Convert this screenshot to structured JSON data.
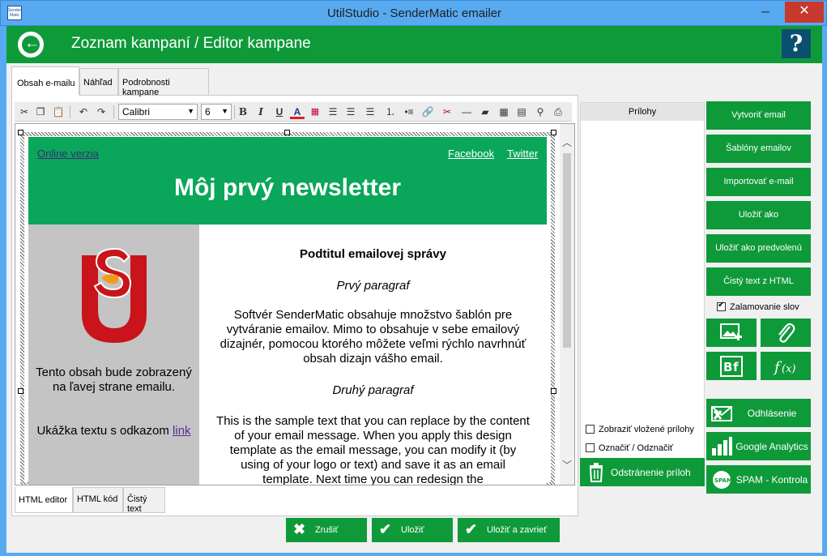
{
  "window": {
    "title": "UtilStudio - SenderMatic emailer",
    "app_icon_text": "Sender Matic"
  },
  "header": {
    "title": "Zoznam kampaní / Editor kampane",
    "help": "?"
  },
  "top_tabs": [
    "Obsah e-mailu",
    "Náhľad",
    "Podrobnosti kampane"
  ],
  "toolbar": {
    "font": "Calibri",
    "size": "6"
  },
  "newsletter": {
    "online_link": "Online verzia",
    "facebook": "Facebook",
    "twitter": "Twitter",
    "title": "Môj prvý newsletter",
    "left_text": "Tento obsah bude zobrazený na ľavej strane emailu.",
    "left_text2_prefix": "Ukážka textu s odkazom",
    "left_link": "link",
    "subtitle": "Podtitul emailovej správy",
    "p1_title": "Prvý paragraf",
    "p1": "Softvér SenderMatic obsahuje množstvo šablón pre vytváranie emailov. Mimo to obsahuje v sebe emailový dizajnér, pomocou ktorého môžete veľmi rýchlo navrhnúť obsah dizajn vášho email.",
    "p2_title": "Druhý paragraf",
    "p2": "This is the sample text that you can replace by the content of your email message. When you apply this design template as the email message, you can modify it (by using of your logo or text) and save it as an email template. Next time you can redesign the"
  },
  "bottom_tabs": [
    "HTML editor",
    "HTML kód",
    "Čistý text"
  ],
  "attachments": {
    "header": "Prílohy",
    "show_embedded": "Zobraziť vložené prílohy",
    "select_toggle": "Označiť / Odznačiť",
    "remove": "Odstránenie príloh"
  },
  "right_buttons": [
    "Vytvoriť email",
    "Šablóny emailov",
    "Importovať e-mail",
    "Uložiť ako",
    "Uložiť ako predvolenú",
    "Čistý text z HTML"
  ],
  "wrap_words": "Zalamovanie slov",
  "feature_buttons": {
    "unsubscribe": "Odhlásenie",
    "analytics": "Google Analytics",
    "spam": "SPAM - Kontrola"
  },
  "bottom_buttons": {
    "cancel": "Zrušiť",
    "save": "Uložiť",
    "save_close": "Uložiť a zavrieť"
  },
  "colors": {
    "accent_green": "#0f9a3a",
    "newsletter_green": "#0aa65a",
    "titlebar": "#58aaf0"
  }
}
